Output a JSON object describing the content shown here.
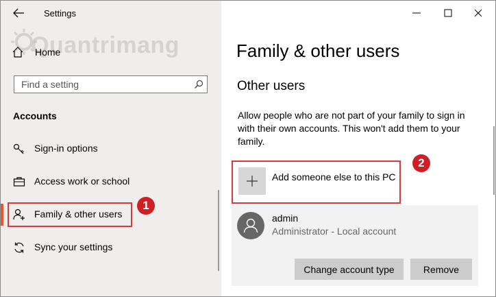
{
  "window": {
    "title": "Settings",
    "controls": [
      "minimize-icon",
      "maximize-icon",
      "close-icon"
    ]
  },
  "sidebar": {
    "watermark": "Quantrimang",
    "home_label": "Home",
    "search_placeholder": "Find a setting",
    "section_heading": "Accounts",
    "items": [
      {
        "label": "Sign-in options",
        "icon": "key-icon"
      },
      {
        "label": "Access work or school",
        "icon": "briefcase-icon"
      },
      {
        "label": "Family & other users",
        "icon": "person-add-icon",
        "selected": true
      },
      {
        "label": "Sync your settings",
        "icon": "sync-icon"
      }
    ],
    "badge_1": "1"
  },
  "main": {
    "title": "Family & other users",
    "section": "Other users",
    "description": "Allow people who are not part of your family to sign in with their own accounts. This won't add them to your family.",
    "add_label": "Add someone else to this PC",
    "badge_2": "2",
    "user": {
      "name": "admin",
      "role": "Administrator - Local account",
      "change_label": "Change account type",
      "remove_label": "Remove"
    }
  },
  "colors": {
    "accent": "#e8542c",
    "highlight": "#d9383c",
    "badge": "#cf1f25",
    "sidebar_bg": "#f0eeec",
    "button_bg": "#cccccc"
  }
}
